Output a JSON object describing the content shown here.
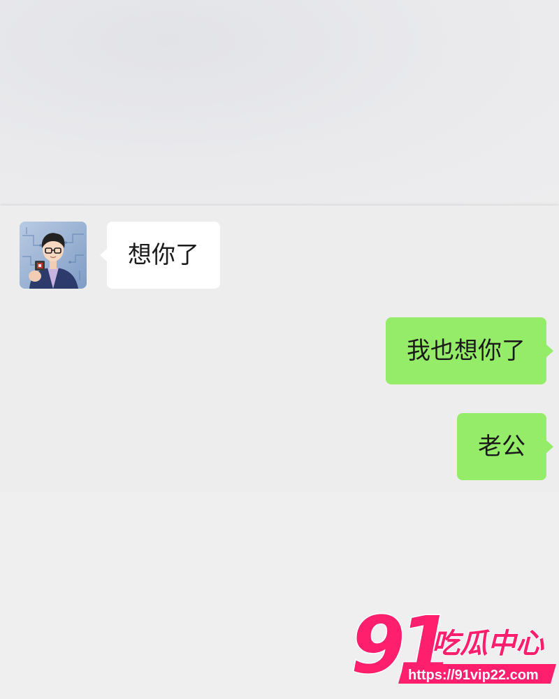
{
  "chat": {
    "messages": [
      {
        "direction": "incoming",
        "text": "想你了",
        "avatar": "avatar-illustration"
      },
      {
        "direction": "outgoing",
        "text": "我也想你了"
      },
      {
        "direction": "outgoing",
        "text": "老公"
      }
    ]
  },
  "watermark": {
    "brand_number": "91",
    "brand_text": "吃瓜中心",
    "url": "https://91vip22.com"
  },
  "colors": {
    "outgoing_bubble": "#95ec69",
    "incoming_bubble": "#ffffff",
    "chat_background": "#ededed",
    "watermark_accent": "#ff1f6d"
  }
}
